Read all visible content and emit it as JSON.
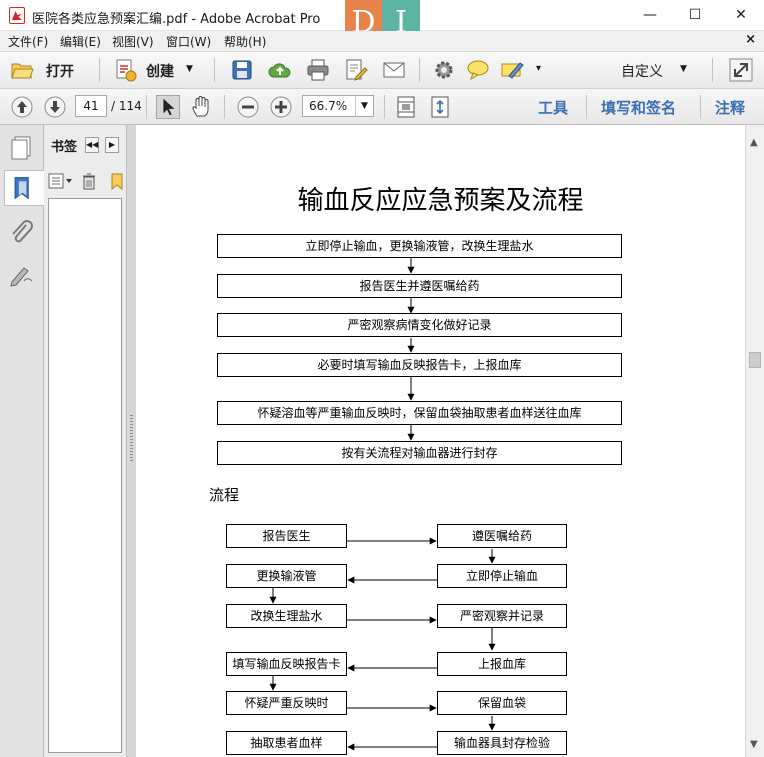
{
  "window": {
    "title": "医院各类应急预案汇编.pdf - Adobe Acrobat Pro",
    "logo_left": "D",
    "logo_right": "I",
    "minimize": "—",
    "maximize": "☐",
    "close": "✕"
  },
  "menu": {
    "items": [
      "文件(F)",
      "编辑(E)",
      "视图(V)",
      "窗口(W)",
      "帮助(H)"
    ],
    "close_doc": "×"
  },
  "toolbar": {
    "open_label": "打开",
    "create_label": "创建",
    "custom_label": "自定义",
    "page_current": "41",
    "page_total": "/ 114",
    "zoom": "66.7%",
    "tools_label": "工具",
    "sign_label": "填写和签名",
    "comment_label": "注释"
  },
  "bookmarks": {
    "title": "书签"
  },
  "document": {
    "title": "输血反应应急预案及流程",
    "steps": [
      "立即停止输血，更换输液管，改换生理盐水",
      "报告医生并遵医嘱给药",
      "严密观察病情变化做好记录",
      "必要时填写输血反映报告卡，上报血库",
      "怀疑溶血等严重输血反映时，保留血袋抽取患者血样送往血库",
      "按有关流程对输血器进行封存"
    ],
    "flow_heading": "流程",
    "flow_left": [
      "报告医生",
      "更换输液管",
      "改换生理盐水",
      "填写输血反映报告卡",
      "怀疑严重反映时",
      "抽取患者血样"
    ],
    "flow_right": [
      "遵医嘱给药",
      "立即停止输血",
      "严密观察并记录",
      "上报血库",
      "保留血袋",
      "输血器具封存检验"
    ]
  }
}
